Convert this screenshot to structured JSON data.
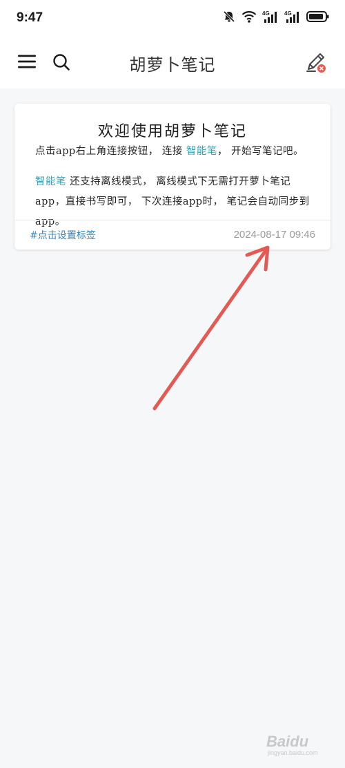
{
  "status_bar": {
    "time": "9:47",
    "icons": [
      "bell-off-icon",
      "wifi-icon",
      "signal-4g-icon",
      "signal-4g-icon",
      "battery-icon"
    ]
  },
  "header": {
    "title": "胡萝卜笔记",
    "menu_icon": "menu-icon",
    "search_icon": "search-icon",
    "pen_icon": "pen-icon"
  },
  "note": {
    "title": "欢迎使用胡萝卜笔记",
    "line1": {
      "a": "点击app右上角连接按钮， 连接 ",
      "highlight": "智能笔",
      "b": "， 开始写笔记吧。"
    },
    "para2": {
      "highlight": "智能笔",
      "text": " 还支持离线模式， 离线模式下无需打开萝卜笔记app，直接书写即可， 下次连接app时， 笔记会自动同步到app。"
    },
    "tag": "#点击设置标签",
    "timestamp": "2024-08-17 09:46"
  },
  "watermark": {
    "brand": "Baidu",
    "sub": "jingyan.baidu.com"
  },
  "colors": {
    "accent": "#3d9fb0",
    "link": "#2f86c2",
    "arrow": "#e35a55",
    "background": "#f6f7f9",
    "pen_badge": "#e8584f"
  }
}
